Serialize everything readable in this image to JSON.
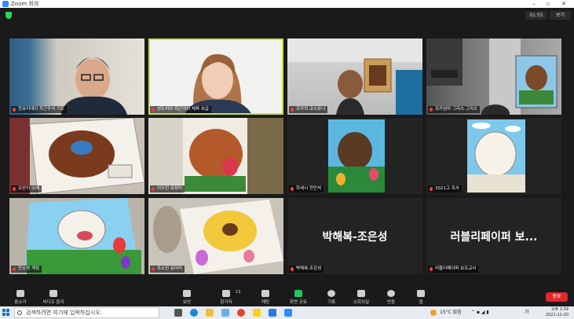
{
  "window": {
    "title": "Zoom 회의"
  },
  "header": {
    "timer": "01:55",
    "view_label": "보기"
  },
  "tiles": [
    {
      "name": "한유리데이 최근주식 기도",
      "big_name": ""
    },
    {
      "name": "성도치아 최근야외 체육 초급",
      "big_name": ""
    },
    {
      "name": "조카의 코스유니",
      "big_name": ""
    },
    {
      "name": "조카엄마 그리스 그리스",
      "big_name": ""
    },
    {
      "name": "오산이 소예",
      "big_name": ""
    },
    {
      "name": "이수민 유정미",
      "big_name": ""
    },
    {
      "name": "하세시 전민석",
      "big_name": ""
    },
    {
      "name": "2021고 조사",
      "big_name": ""
    },
    {
      "name": "안소영 게림",
      "big_name": ""
    },
    {
      "name": "조소진 유미리",
      "big_name": ""
    },
    {
      "name": "박해복-조은성",
      "big_name": "박해복-조은성"
    },
    {
      "name": "러블리페이퍼 보조교사",
      "big_name": "러블리페이퍼 보..."
    }
  ],
  "toolbar": {
    "mute": "음소거",
    "stop_video": "비디오 중지",
    "security": "보안",
    "participants": "참가자",
    "participant_count": "13",
    "chat": "채팅",
    "share_screen": "화면 공유",
    "record": "기록",
    "breakout": "소회의실",
    "reactions": "반응",
    "apps": "앱",
    "end": "종료"
  },
  "taskbar": {
    "search_placeholder": "검색하려면 여기에 입력하십시오.",
    "weather": "15°C 맑음",
    "lang": "가",
    "time": "오후 2:59",
    "date": "2021-11-20"
  },
  "colors": {
    "active_speaker": "#c8e04a",
    "end_button": "#e02828",
    "share_screen": "#22c55e",
    "muted_mic": "#e8403b"
  }
}
